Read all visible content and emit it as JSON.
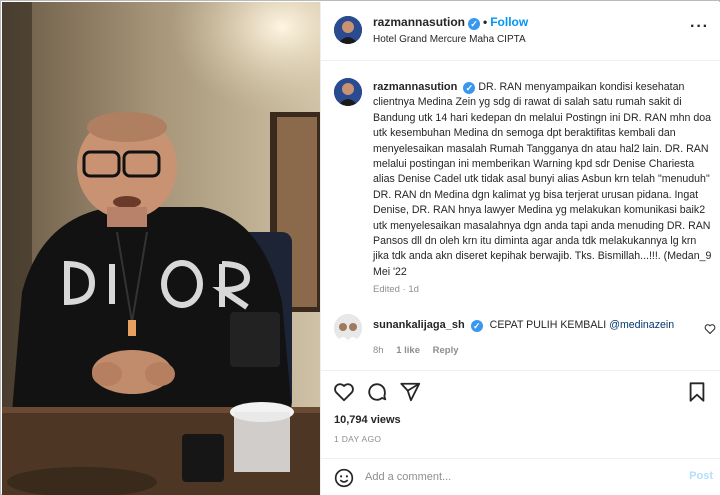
{
  "header": {
    "username": "razmannasution",
    "follow_label": "Follow",
    "location": "Hotel Grand Mercure Maha CIPTA"
  },
  "media": {
    "description_icon": "video-photo",
    "shirt_text": "DIOR"
  },
  "caption": {
    "username": "razmannasution",
    "text": "DR. RAN menyampaikan kondisi kesehatan clientnya Medina Zein yg sdg di rawat di salah satu rumah sakit di Bandung utk 14 hari kedepan dn melalui Postingn ini DR. RAN mhn doa utk kesembuhan Medina dn semoga dpt beraktifitas kembali dan menyelesaikan masalah Rumah Tangganya dn atau hal2 lain. DR. RAN melalui postingan ini memberikan Warning kpd sdr Denise Chariesta alias Denise Cadel utk tidak asal bunyi alias Asbun krn telah \"menuduh\" DR. RAN dn Medina dgn kalimat yg bisa terjerat urusan pidana. Ingat Denise, DR. RAN hnya lawyer Medina yg melakukan komunikasi baik2 utk menyelesaikan masalahnya dgn anda tapi anda menuding DR. RAN Pansos dll dn oleh krn itu diminta agar anda tdk melakukannya lg krn jika tdk anda akn diseret kepihak berwajib. Tks. Bismillah...!!!. (Medan_9 Mei '22",
    "edited": "Edited · 1d"
  },
  "comment": {
    "username": "sunankalijaga_sh",
    "text": "CEPAT PULIH KEMBALI",
    "mention": "@medinazein",
    "age": "8h",
    "likes": "1 like",
    "reply": "Reply"
  },
  "stats": {
    "views": "10,794 views",
    "posted": "1 DAY AGO"
  },
  "add_comment": {
    "placeholder": "Add a comment...",
    "post_label": "Post"
  },
  "colors": {
    "verified": "#3897f0",
    "follow": "#0095f6",
    "post_disabled": "#b2dffc"
  },
  "icons": [
    "heart-icon",
    "comment-icon",
    "share-icon",
    "bookmark-icon",
    "emoji-icon",
    "verified-icon",
    "more-icon"
  ]
}
